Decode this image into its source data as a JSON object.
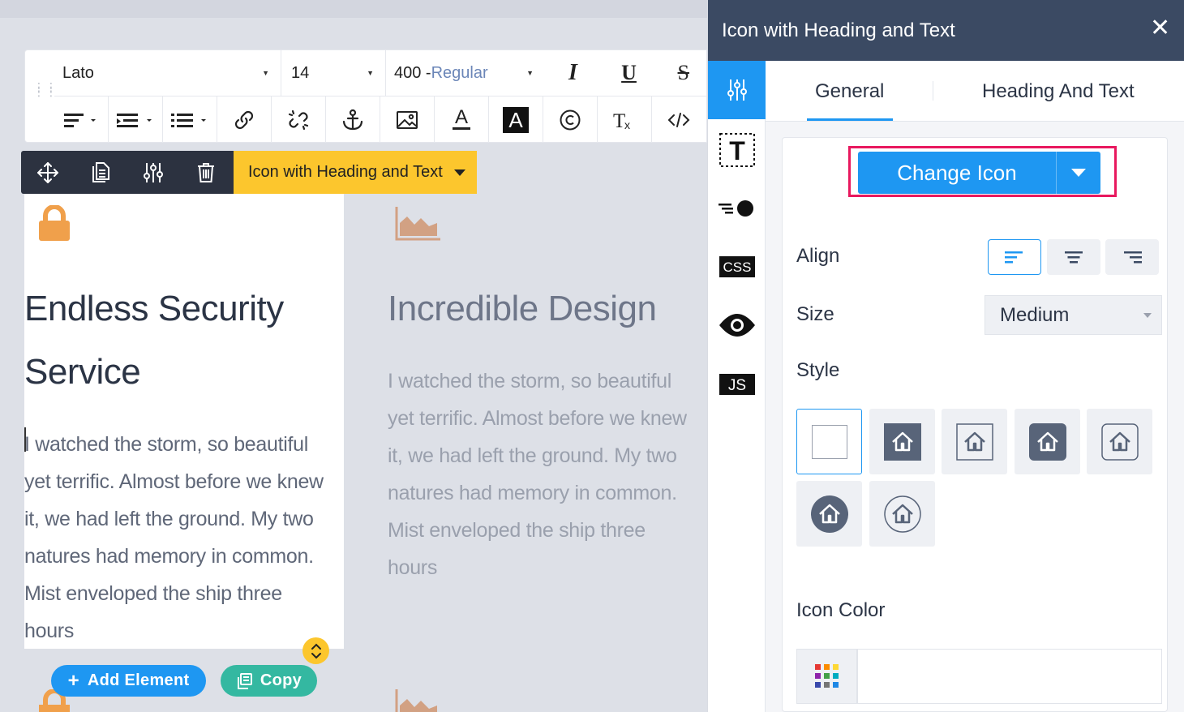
{
  "colors": {
    "accent": "#1e97f2",
    "highlight": "#e8185e",
    "element_label_bg": "#fcc62d",
    "panel_header_bg": "#3b4a63",
    "lock_icon": "#f0a04b",
    "chart_icon": "#d2a183"
  },
  "text_toolbar": {
    "font_family": "Lato",
    "font_size": "14",
    "font_weight_number": "400 -",
    "font_weight_name": "Regular",
    "italic_label": "I",
    "underline_label": "U",
    "strike_label": "S"
  },
  "element_toolbar": {
    "label": "Icon with Heading and Text"
  },
  "columns": [
    {
      "icon": "lock-icon",
      "heading_line1": "Endless Security",
      "heading_line2": "Service",
      "paragraph_lines": [
        "I watched the storm, so beautiful",
        "yet terrific. Almost before we knew",
        "it, we had left the ground. My two",
        "natures had memory in common.",
        "Mist enveloped the ship three",
        "hours"
      ]
    },
    {
      "icon": "area-chart-icon",
      "heading_line1": "Incredible Design",
      "paragraph_lines": [
        "I watched the storm, so beautiful",
        "yet terrific. Almost before we knew",
        "it, we had left the ground. My two",
        "natures had memory in common.",
        "Mist enveloped the ship three",
        "hours"
      ]
    }
  ],
  "bottom_actions": {
    "add_element": "Add Element",
    "copy": "Copy"
  },
  "panel": {
    "title": "Icon with Heading and Text",
    "tabs": [
      "General",
      "Heading And Text"
    ],
    "active_tab": "General",
    "rail_items": [
      "settings-sliders-icon",
      "text-icon",
      "motion-icon",
      "css-icon",
      "visibility-icon",
      "js-icon"
    ],
    "rail_labels": {
      "css": "CSS",
      "js": "JS"
    },
    "change_icon_label": "Change Icon",
    "align_label": "Align",
    "align_selected": "left",
    "size_label": "Size",
    "size_value": "Medium",
    "style_label": "Style",
    "style_selected_index": 0,
    "icon_color_label": "Icon Color",
    "icon_color_value": ""
  }
}
